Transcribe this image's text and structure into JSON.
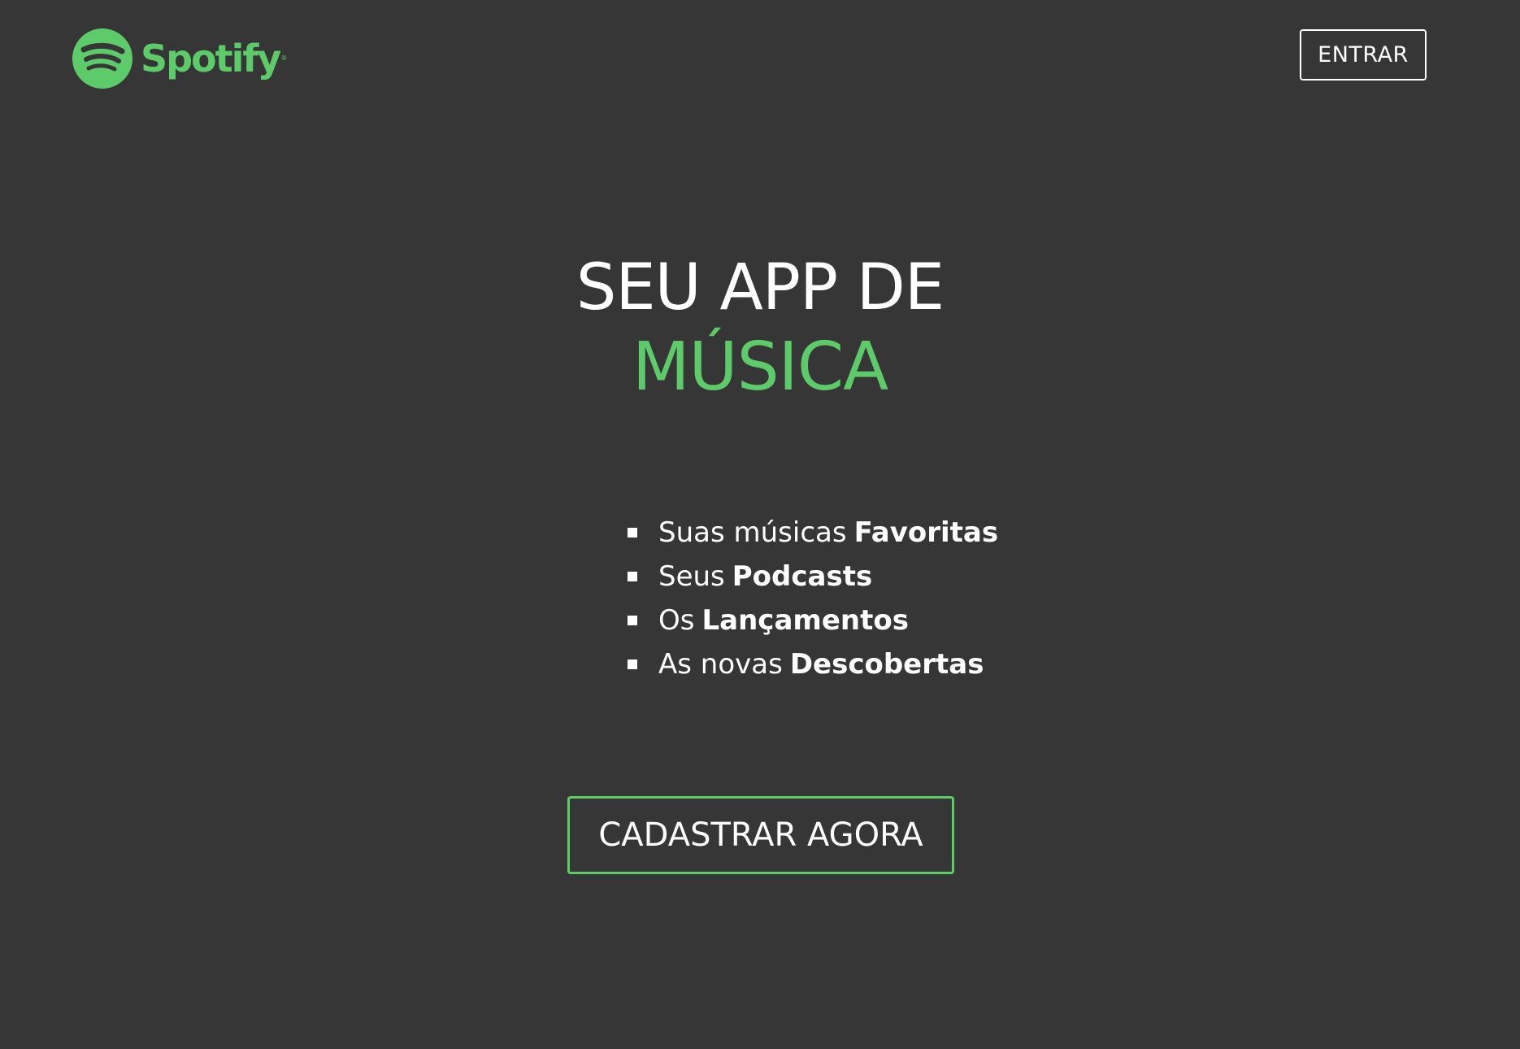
{
  "header": {
    "logo_text": "Spotify",
    "logo_icon": "spotify-logo-icon",
    "login_label": "ENTRAR"
  },
  "hero": {
    "line1": "SEU APP DE",
    "line2": "MÚSICA"
  },
  "features": [
    {
      "regular": "Suas músicas",
      "bold": "Favoritas"
    },
    {
      "regular": "Seus",
      "bold": "Podcasts"
    },
    {
      "regular": "Os",
      "bold": "Lançamentos"
    },
    {
      "regular": "As novas",
      "bold": "Descobertas"
    }
  ],
  "cta": {
    "label": "CADASTRAR AGORA"
  },
  "colors": {
    "background": "#363636",
    "accent": "#5ecb6a",
    "text": "#ffffff"
  }
}
